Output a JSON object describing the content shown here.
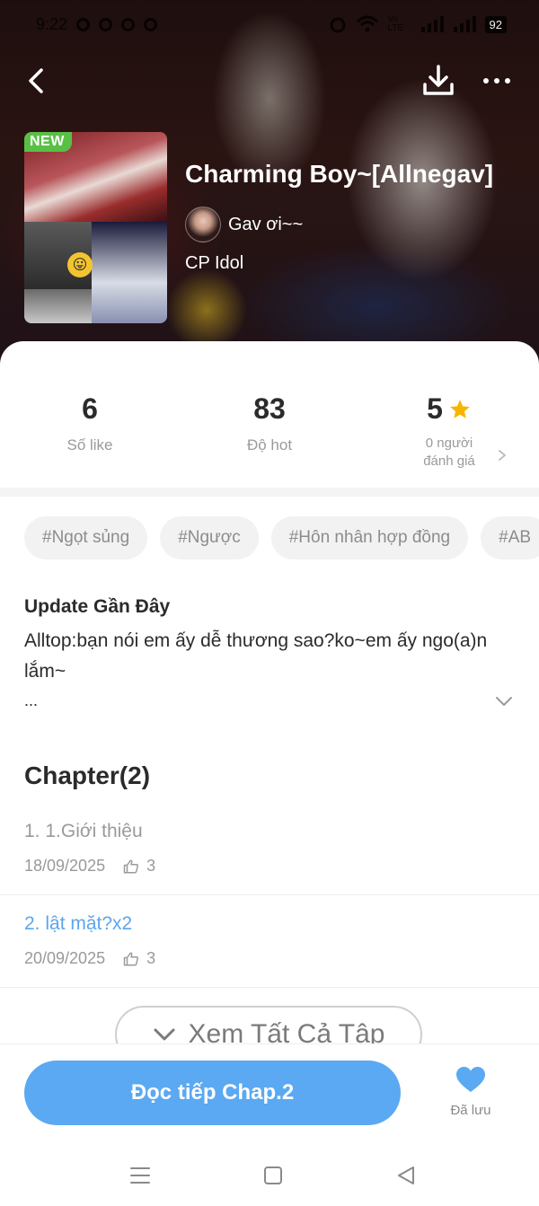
{
  "status_bar": {
    "time": "9:22",
    "carrier": "Vo LTE",
    "battery": "92"
  },
  "header": {
    "new_badge": "NEW",
    "title": "Charming Boy~[Allnegav]",
    "author": "Gav ơi~~",
    "category": "CP Idol"
  },
  "stats": {
    "likes": {
      "value": "6",
      "label": "Số like"
    },
    "hot": {
      "value": "83",
      "label": "Độ hot"
    },
    "rating": {
      "value": "5",
      "label_line1": "0 người",
      "label_line2": "đánh giá"
    }
  },
  "tags": [
    "#Ngọt sủng",
    "#Ngược",
    "#Hôn nhân hợp đồng",
    "#AB"
  ],
  "update": {
    "title": "Update Gần Đây",
    "text": "Alltop:bạn nói em ấy dễ thương sao?ko~em ấy ngo(a)n lắm~",
    "ellipsis": "..."
  },
  "chapters": {
    "title": "Chapter(2)",
    "items": [
      {
        "title": "1. 1.Giới thiệu",
        "date": "18/09/2025",
        "likes": "3"
      },
      {
        "title": "2. lật mặt?x2",
        "date": "20/09/2025",
        "likes": "3"
      }
    ],
    "see_all_label": "Xem Tất Cả Tập"
  },
  "bottom_bar": {
    "read_button": "Đọc tiếp Chap.2",
    "saved_label": "Đã lưu"
  },
  "colors": {
    "accent": "#5aa9f2",
    "new_badge": "#59c046",
    "star": "#f7b500",
    "active_chapter": "#5aa6ee"
  }
}
